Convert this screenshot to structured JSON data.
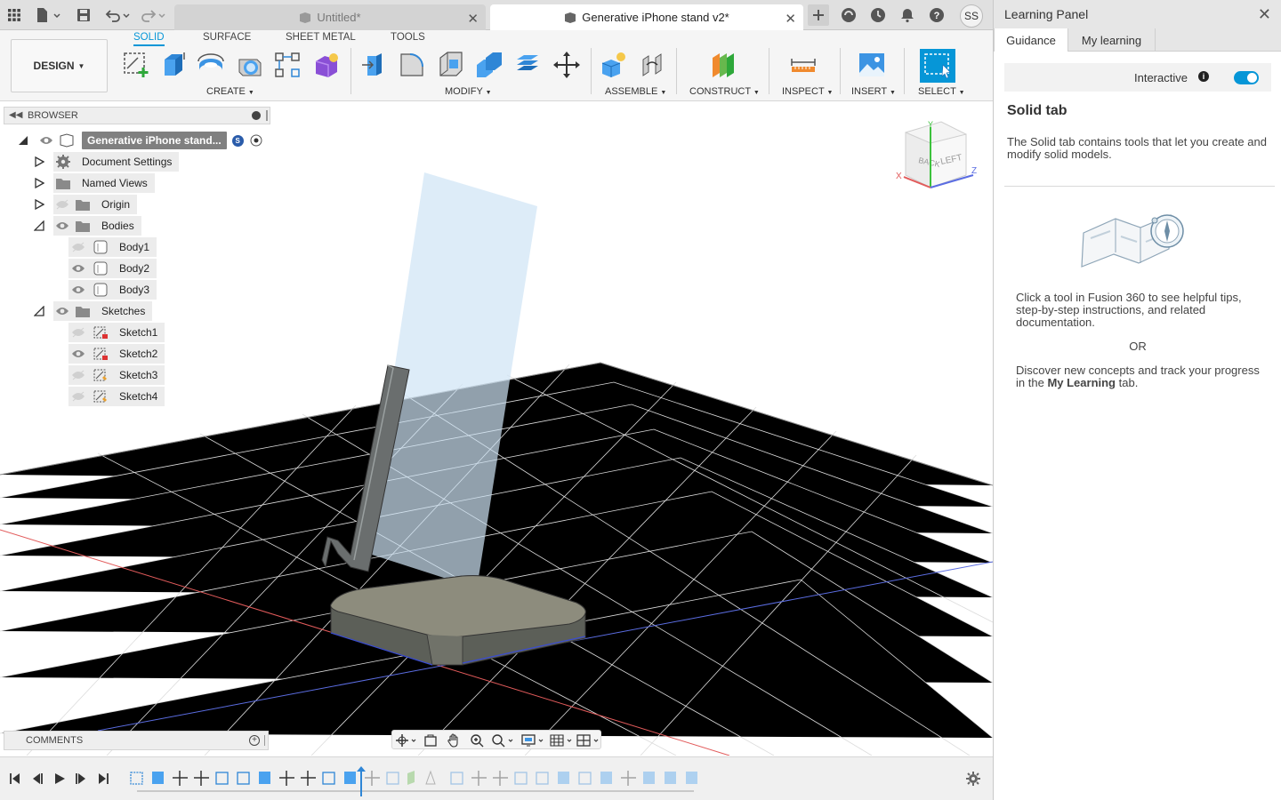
{
  "titlebar": {
    "tabs": [
      {
        "label": "Untitled*",
        "active": false
      },
      {
        "label": "Generative iPhone stand v2*",
        "active": true
      }
    ],
    "user_initials": "SS"
  },
  "toolbar": {
    "workspace": "DESIGN",
    "tabs": [
      "SOLID",
      "SURFACE",
      "SHEET METAL",
      "TOOLS"
    ],
    "active_tab": "SOLID",
    "groups": [
      "CREATE",
      "MODIFY",
      "ASSEMBLE",
      "CONSTRUCT",
      "INSPECT",
      "INSERT",
      "SELECT"
    ],
    "accent_color": "#0696d7"
  },
  "browser": {
    "header": "BROWSER",
    "root": "Generative iPhone stand...",
    "root_badge": "S",
    "items": [
      {
        "label": "Document Settings",
        "kind": "settings"
      },
      {
        "label": "Named Views",
        "kind": "folder"
      },
      {
        "label": "Origin",
        "kind": "folder"
      },
      {
        "label": "Bodies",
        "kind": "folder"
      },
      {
        "label": "Body1",
        "kind": "body"
      },
      {
        "label": "Body2",
        "kind": "body"
      },
      {
        "label": "Body3",
        "kind": "body"
      },
      {
        "label": "Sketches",
        "kind": "folder"
      },
      {
        "label": "Sketch1",
        "kind": "sketch"
      },
      {
        "label": "Sketch2",
        "kind": "sketch"
      },
      {
        "label": "Sketch3",
        "kind": "sketch"
      },
      {
        "label": "Sketch4",
        "kind": "sketch"
      }
    ]
  },
  "comments": {
    "label": "COMMENTS"
  },
  "viewcube": {
    "faces": [
      "BACK",
      "LEFT"
    ],
    "axes": [
      "X",
      "Y",
      "Z"
    ]
  },
  "learning_panel": {
    "title": "Learning Panel",
    "tabs": [
      "Guidance",
      "My learning"
    ],
    "active_tab": "Guidance",
    "interactive_label": "Interactive",
    "interactive_on": true,
    "heading": "Solid tab",
    "description": "The Solid tab contains tools that let you create and modify solid models.",
    "tip": "Click a tool in Fusion 360 to see helpful tips, step-by-step instructions, and related documentation.",
    "or": "OR",
    "discover_prefix": "Discover new concepts and track your progress in the",
    "discover_link": "My Learning",
    "discover_suffix": "tab."
  }
}
